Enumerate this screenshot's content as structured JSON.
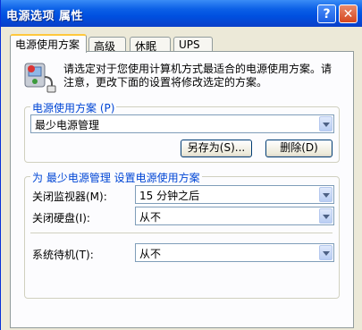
{
  "window": {
    "title": "电源选项 属性",
    "help_label": "?",
    "close_label": "✕"
  },
  "tabs": [
    {
      "label": "电源使用方案"
    },
    {
      "label": "高级"
    },
    {
      "label": "休眠"
    },
    {
      "label": "UPS"
    }
  ],
  "description": "请选定对于您使用计算机方式最适合的电源使用方案。请注意，更改下面的设置将修改选定的方案。",
  "scheme_group": {
    "legend": "电源使用方案 (P)",
    "selected": "最少电源管理",
    "save_as_label": "另存为(S)...",
    "delete_label": "删除(D)"
  },
  "settings_group": {
    "legend": "为 最少电源管理 设置电源使用方案",
    "monitor_label": "关闭监视器(M):",
    "monitor_value": "15 分钟之后",
    "disk_label": "关闭硬盘(I):",
    "disk_value": "从不",
    "standby_label": "系统待机(T):",
    "standby_value": "从不"
  },
  "icon": "power-plug-icon"
}
